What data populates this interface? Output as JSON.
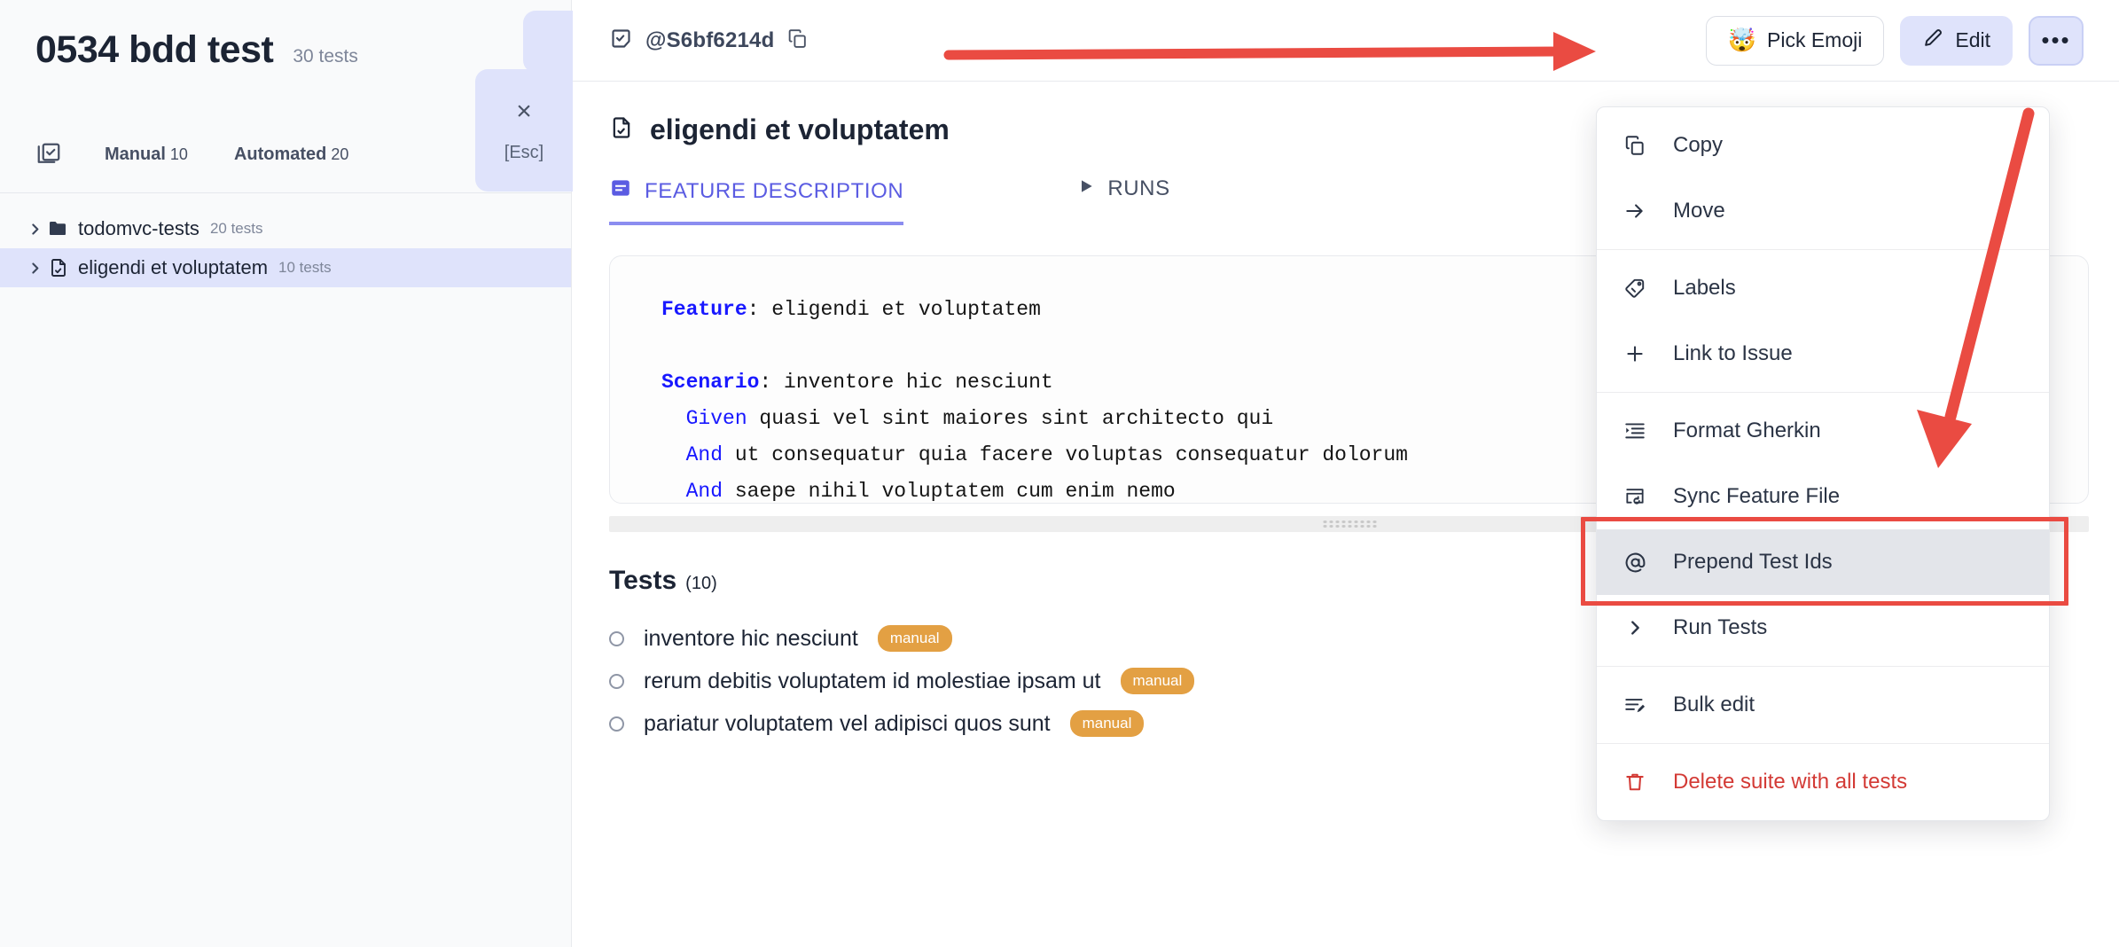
{
  "left": {
    "suite_title": "0534 bdd test",
    "suite_count": "30 tests",
    "tabs_icon": "checklist-icon",
    "tabs": [
      {
        "label": "Manual",
        "count": "10"
      },
      {
        "label": "Automated",
        "count": "20"
      }
    ],
    "tree": [
      {
        "icon": "folder-icon",
        "label": "todomvc-tests",
        "count": "20 tests",
        "selected": false
      },
      {
        "icon": "file-check-icon",
        "label": "eligendi et voluptatem",
        "count": "10 tests",
        "selected": true
      }
    ],
    "close_overlay": {
      "x_glyph": "×",
      "key_label": "[Esc]"
    }
  },
  "main": {
    "suite_id": "@S6bf6214d",
    "suite_id_icon": "test-case-icon",
    "copy_icon": "copy-icon",
    "actions": {
      "emoji_glyph": "🤯",
      "emoji_label": "Pick Emoji",
      "edit_label": "Edit",
      "edit_icon": "pencil-icon",
      "more_label": "•••"
    },
    "feature": {
      "icon": "file-check-icon",
      "title": "eligendi et voluptatem"
    },
    "content_tabs": [
      {
        "label": "FEATURE DESCRIPTION",
        "icon": "description-icon",
        "active": true
      },
      {
        "label": "RUNS",
        "icon": "play-icon",
        "active": false
      }
    ],
    "gherkin": {
      "lines": [
        [
          {
            "t": "Feature",
            "c": "kw"
          },
          {
            "t": ": eligendi et voluptatem",
            "c": ""
          }
        ],
        [
          {
            "t": "",
            "c": ""
          }
        ],
        [
          {
            "t": "Scenario",
            "c": "kw"
          },
          {
            "t": ": inventore hic nesciunt",
            "c": ""
          }
        ],
        [
          {
            "t": "  ",
            "c": ""
          },
          {
            "t": "Given",
            "c": "kw2"
          },
          {
            "t": " quasi vel sint maiores sint architecto qui",
            "c": ""
          }
        ],
        [
          {
            "t": "  ",
            "c": ""
          },
          {
            "t": "And",
            "c": "kw2"
          },
          {
            "t": " ut consequatur quia facere voluptas consequatur dolorum",
            "c": ""
          }
        ],
        [
          {
            "t": "  ",
            "c": ""
          },
          {
            "t": "And",
            "c": "kw2"
          },
          {
            "t": " saepe nihil voluptatem cum enim nemo",
            "c": ""
          }
        ]
      ]
    },
    "resize_handle": "resize-grip",
    "tests_section": {
      "heading": "Tests",
      "count": "(10)",
      "items": [
        {
          "name": "inventore hic nesciunt",
          "badge": "manual"
        },
        {
          "name": "rerum debitis voluptatem id molestiae ipsam ut",
          "badge": "manual"
        },
        {
          "name": "pariatur voluptatem vel adipisci quos sunt",
          "badge": "manual"
        }
      ]
    }
  },
  "menu": {
    "items": [
      {
        "label": "Copy",
        "icon": "copy-icon",
        "kind": "normal"
      },
      {
        "label": "Move",
        "icon": "arrow-right-icon",
        "kind": "normal"
      },
      {
        "sep": true
      },
      {
        "label": "Labels",
        "icon": "tag-icon",
        "kind": "normal"
      },
      {
        "label": "Link to Issue",
        "icon": "plus-icon",
        "kind": "normal"
      },
      {
        "sep": true
      },
      {
        "label": "Format Gherkin",
        "icon": "format-indent-icon",
        "kind": "normal"
      },
      {
        "label": "Sync Feature File",
        "icon": "sync-file-icon",
        "kind": "normal"
      },
      {
        "label": "Prepend Test Ids",
        "icon": "at-sign-icon",
        "kind": "highlighted"
      },
      {
        "label": "Run Tests",
        "icon": "chevron-right-icon",
        "kind": "normal"
      },
      {
        "sep": true
      },
      {
        "label": "Bulk edit",
        "icon": "list-edit-icon",
        "kind": "normal"
      },
      {
        "sep": true
      },
      {
        "label": "Delete suite with all tests",
        "icon": "trash-icon",
        "kind": "danger"
      }
    ]
  },
  "annotations": {
    "accent_red": "#ea4b42",
    "arrow_horizontal": "points right toward Pick Emoji button",
    "arrow_diagonal": "points down-left toward Prepend Test Ids",
    "highlight_box": "red rectangle around Prepend Test Ids"
  },
  "colors": {
    "selected_row": "#dfe3fb",
    "accent_purple": "#5b5ce2",
    "badge_orange": "#e3a043",
    "danger_red": "#d33a35",
    "text_dark": "#1c2434",
    "text_muted": "#7e8699"
  }
}
